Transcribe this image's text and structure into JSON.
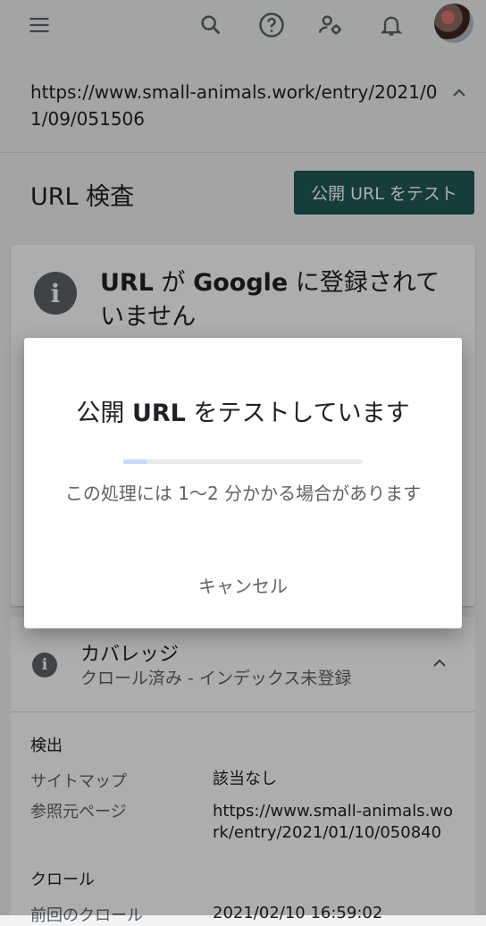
{
  "topbar": {
    "icons": [
      "menu-icon",
      "search-icon",
      "help-icon",
      "manage-users-icon",
      "notifications-icon"
    ]
  },
  "url_row": {
    "url": "https://www.small-animals.work/entry/2021/01/09/051506"
  },
  "header": {
    "title": "URL 検査",
    "test_button": "公開 URL をテスト"
  },
  "status_card": {
    "title_prefix": "URL",
    "title_mid": " が ",
    "title_brand": "Google",
    "title_suffix": " に登録されていません"
  },
  "coverage": {
    "title": "カバレッジ",
    "subtitle": "クロール済み - インデックス未登録",
    "discovery_heading": "検出",
    "sitemap_label": "サイトマップ",
    "sitemap_value": "該当なし",
    "referring_label": "参照元ページ",
    "referring_value": "https://www.small-animals.work/entry/2021/01/10/050840",
    "crawl_heading": "クロール",
    "last_crawl_label": "前回のクロール",
    "last_crawl_value": "2021/02/10 16:59:02"
  },
  "dialog": {
    "title_a": "公開 ",
    "title_b": "URL",
    "title_c": " をテストしています",
    "progress": 0.1,
    "message": "この処理には 1〜2 分かかる場合があります",
    "cancel_label": "キャンセル"
  },
  "colors": {
    "accent": "#1e5b58",
    "scrim": "rgba(0,0,0,0.32)"
  }
}
